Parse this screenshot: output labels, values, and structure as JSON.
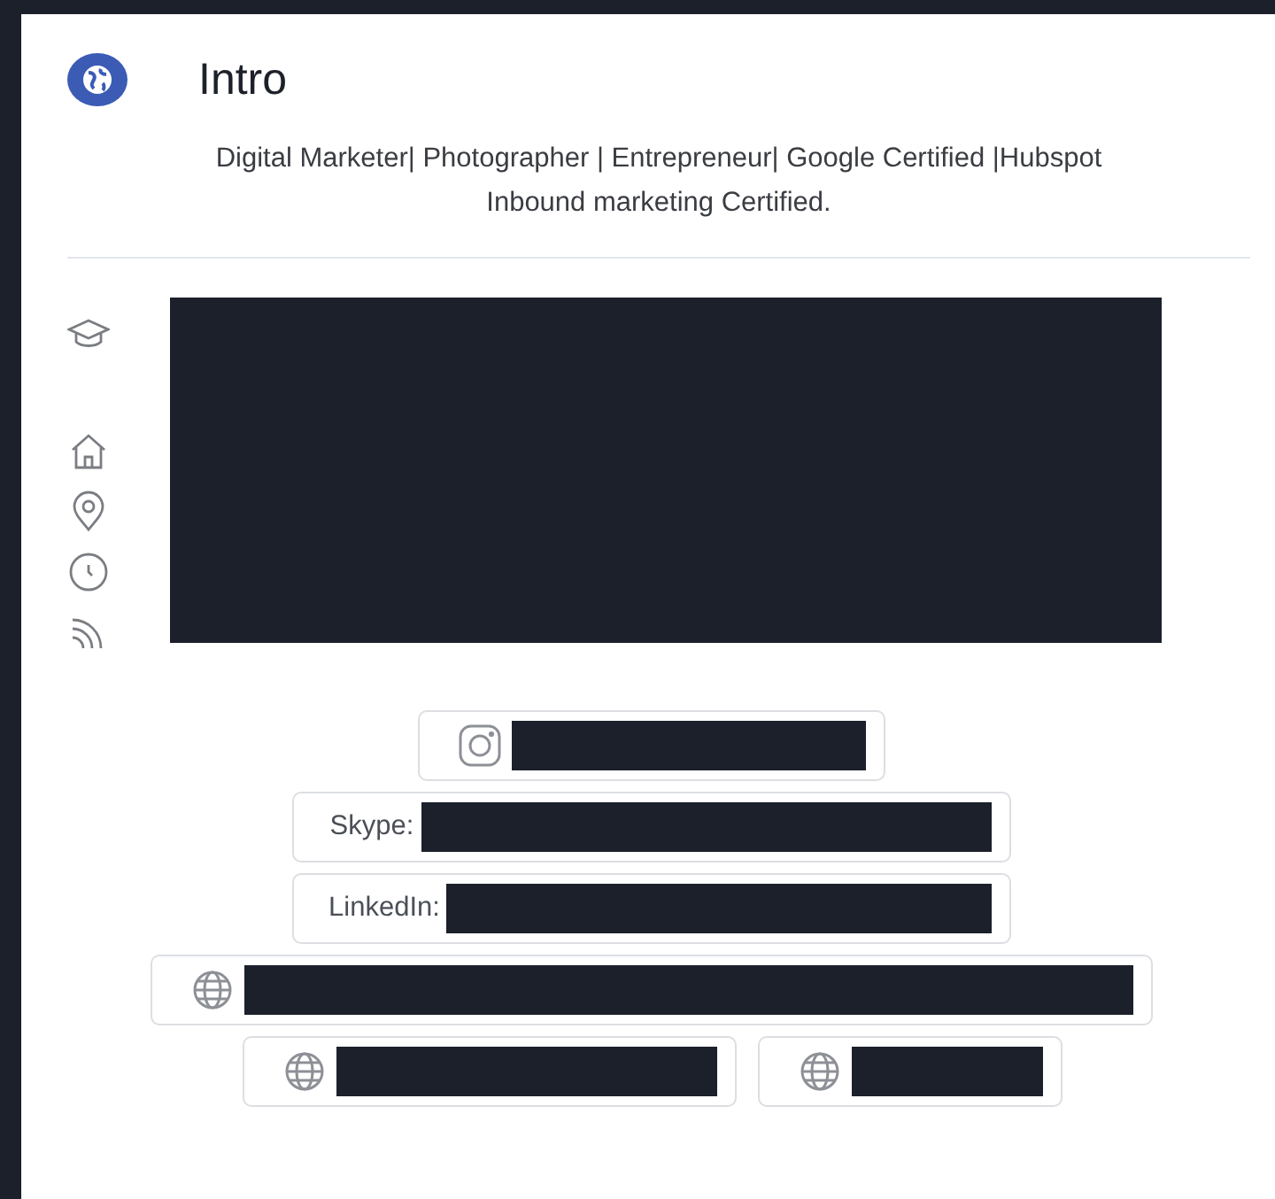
{
  "header": {
    "title": "Intro"
  },
  "bio": "Digital Marketer| Photographer | Entrepreneur| Google Certified |Hubspot Inbound marketing Certified.",
  "details": {
    "redacted": true
  },
  "link_rows": [
    [
      {
        "kind": "instagram",
        "redacted": true
      }
    ],
    [
      {
        "kind": "text",
        "label": "Skype:",
        "redacted": true
      }
    ],
    [
      {
        "kind": "text",
        "label": "LinkedIn:",
        "redacted": true
      }
    ],
    [
      {
        "kind": "web",
        "redacted": true
      }
    ],
    [
      {
        "kind": "web",
        "redacted": true
      },
      {
        "kind": "web",
        "redacted": true
      }
    ]
  ]
}
